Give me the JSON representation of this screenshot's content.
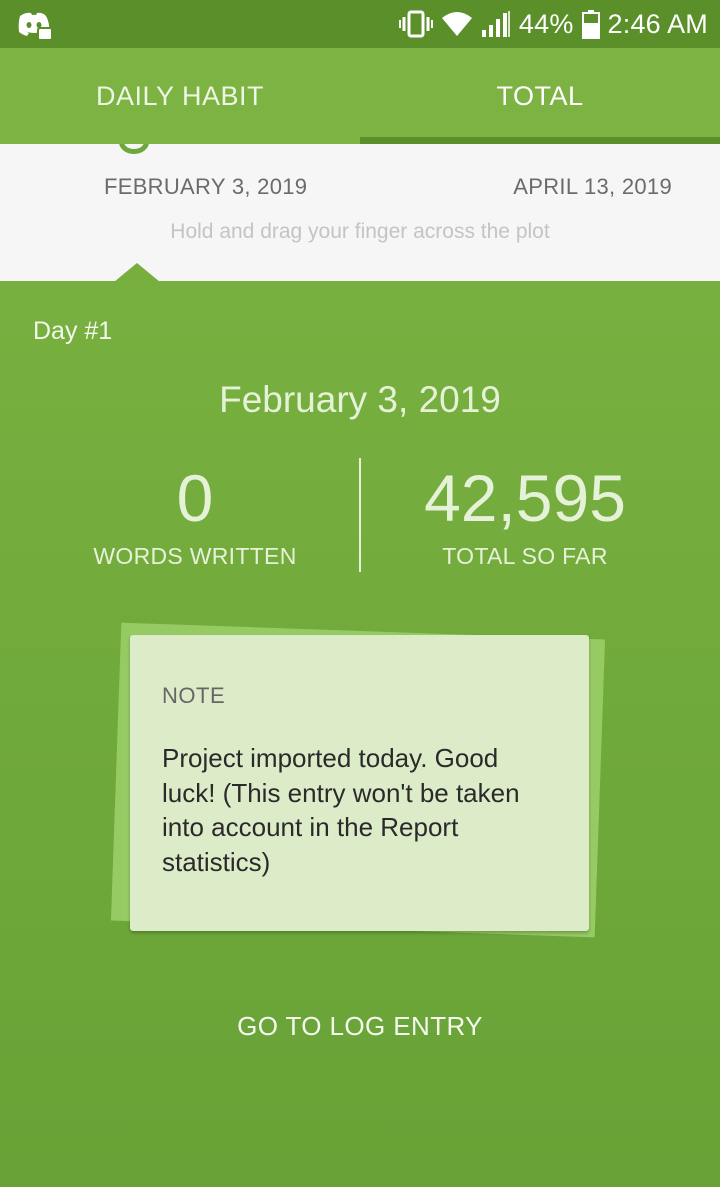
{
  "status_bar": {
    "app_icon": "discord-icon",
    "vibrate_icon": "vibrate-icon",
    "wifi_icon": "wifi-icon",
    "signal_icon": "signal-icon",
    "battery_icon": "battery-icon",
    "battery": "44%",
    "time": "2:46 AM"
  },
  "tabs": {
    "daily": "DAILY HABIT",
    "total": "TOTAL",
    "selected": "TOTAL"
  },
  "range": {
    "start": "FEBRUARY 3, 2019",
    "end": "APRIL 13, 2019",
    "hint": "Hold and drag your finger across the plot"
  },
  "detail": {
    "day": "Day #1",
    "date": "February 3, 2019",
    "words_value": "0",
    "words_label": "WORDS WRITTEN",
    "total_value": "42,595",
    "total_label": "TOTAL SO FAR"
  },
  "note": {
    "title": "NOTE",
    "body": "Project imported today. Good luck! (This entry won't be taken into account in the Report statistics)"
  },
  "actions": {
    "log_entry": "GO TO LOG ENTRY"
  },
  "colors": {
    "status_bar": "#5a8f2a",
    "tab_bar": "#7cb342",
    "panel": "#6ea83a",
    "note": "#ddecc8"
  }
}
